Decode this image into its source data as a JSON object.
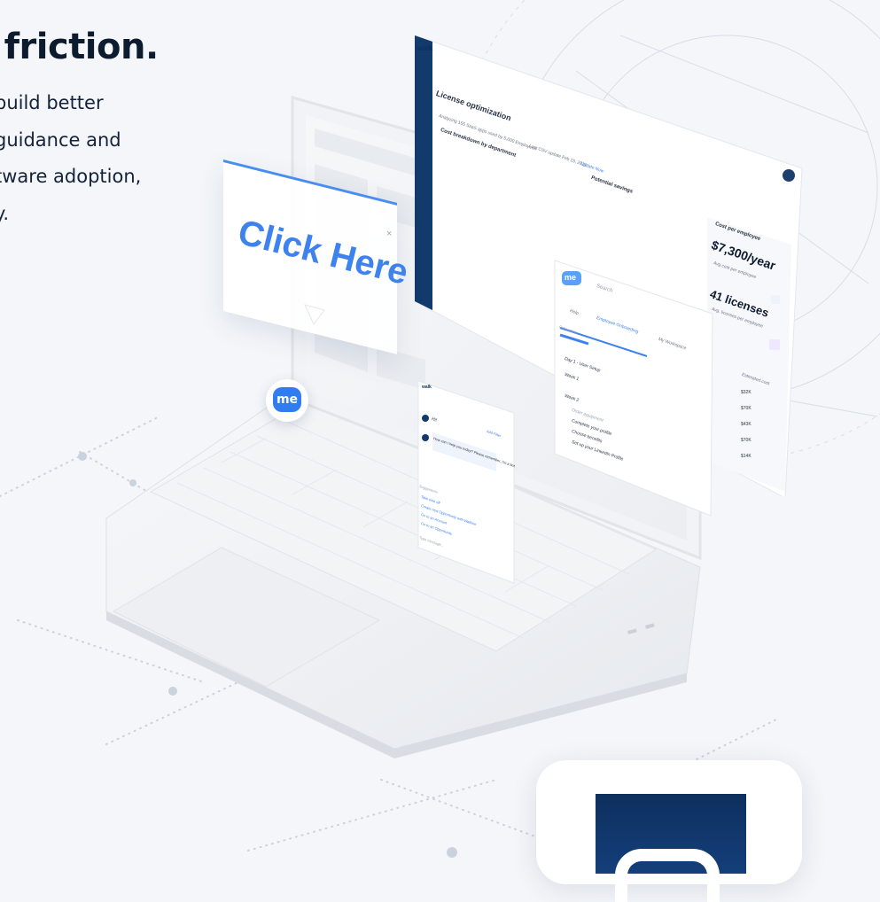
{
  "hero": {
    "headline": "l friction.",
    "lines": [
      "build better",
      "guidance and",
      "tware adoption,",
      "y."
    ]
  },
  "click_card": {
    "label": "Click Here",
    "close": "×"
  },
  "dashboard": {
    "app_logo": "walk",
    "title": "License optimization",
    "subtitle": "Analyzing 155 SaaS apps used by 5,000 Employees",
    "last_update": "Last CSV update Feb 15, 2022",
    "update_link": "Update Now",
    "section": "Cost breakdown by department",
    "potential_savings": "Potential savings",
    "cost_per_employee_label": "Cost per employee",
    "cost_per_employee_value": "$7,300/year",
    "avg_cost_caption": "Avg cost per employee",
    "licenses_value": "41 licenses",
    "licenses_caption": "Avg. licenses per employee",
    "estimated_label": "Estimated cost",
    "estimated_values": [
      "$32K",
      "$70K",
      "$43K",
      "$70K",
      "$14K"
    ]
  },
  "onboarding": {
    "logo": "me",
    "search_placeholder": "Search",
    "tabs": [
      "Help",
      "Employee Onboarding",
      "My Workspace"
    ],
    "progress_label": "Onboarding",
    "groups": [
      "Day 1 - User Setup",
      "Week 1",
      "Week 2"
    ],
    "tasks": [
      "Order equipment",
      "Complete your profile",
      "Choose benefits",
      "Set up your LinkedIn Profile"
    ]
  },
  "chat": {
    "logo": "walk",
    "greeting": "Hi!",
    "add_filter": "Add Filter",
    "prompt": "How can I help you today? Please remember, I'm a bot",
    "suggestions_title": "Suggestions",
    "suggestions": [
      "Take time off",
      "Create new Opportunity with Walkme",
      "Go to an Account",
      "Go to an Opportunity"
    ],
    "input_placeholder": "Type message..."
  },
  "widget": {
    "label": "me"
  },
  "colors": {
    "accent": "#3e82ee",
    "navy": "#0e2f5e",
    "text": "#0d1b2e",
    "purple": "#8b6cf0"
  }
}
